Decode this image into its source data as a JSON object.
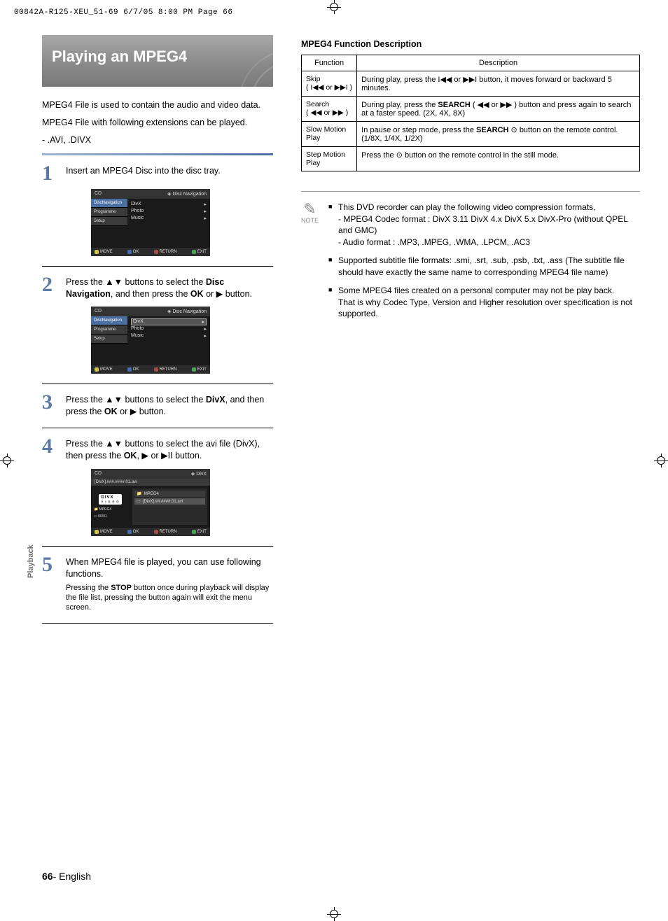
{
  "print_header": "00842A-R125-XEU_51-69  6/7/05  8:00 PM  Page 66",
  "side_tab": "Playback",
  "footer_page": "66",
  "footer_lang": "- English",
  "title": "Playing an MPEG4",
  "intro_lines": [
    "MPEG4 File is used to contain the audio and video data.",
    "MPEG4 File with following extensions can be played.",
    "- .AVI, .DIVX"
  ],
  "steps": {
    "s1": {
      "num": "1",
      "text": "Insert an MPEG4 Disc into the disc tray."
    },
    "s2": {
      "num": "2",
      "text_pre": "Press the ",
      "arrows": "▲▼",
      "text_mid": " buttons to select the ",
      "bold1": "Disc Navigation",
      "text_mid2": ", and then press the ",
      "bold2": "OK",
      "text_end": " or ▶ button."
    },
    "s3": {
      "num": "3",
      "text_pre": "Press the ",
      "arrows": "▲▼",
      "text_mid": " buttons to select the ",
      "bold1": "DivX",
      "text_mid2": ", and then press the ",
      "bold2": "OK",
      "text_end": " or ▶ button."
    },
    "s4": {
      "num": "4",
      "text_pre": "Press the ",
      "arrows": "▲▼",
      "text_mid": " buttons to select the avi file (DivX), then press the ",
      "bold1": "OK",
      "text_end": ", ▶ or ▶II button."
    },
    "s5": {
      "num": "5",
      "text": "When MPEG4 file is played, you can use following functions.",
      "sub_pre": "Pressing the ",
      "sub_bold": "STOP",
      "sub_post": " button once during playback will display the file list, pressing the button again will exit the menu screen."
    }
  },
  "osd_common": {
    "title_left": "CD",
    "nav_label": "Disc Navigation",
    "side_items": [
      "DiscNavigation",
      "Programme",
      "Setup"
    ],
    "main_items": [
      "DivX",
      "Photo",
      "Music"
    ],
    "bottom": {
      "move": "MOVE",
      "ok": "OK",
      "return": "RETURN",
      "exit": "EXIT"
    }
  },
  "osd3": {
    "title_left": "CD",
    "title_right": "DivX",
    "bar": "[DivX].###.####.01.avi",
    "logo": "DIVX",
    "logo_sub": "V I D E O",
    "left_meta1": "MPEG4",
    "left_meta2": "00/01",
    "right_h": "MPEG4",
    "right_row": "[DivX].##.####.01.avi"
  },
  "right": {
    "heading": "MPEG4 Function Description",
    "th_func": "Function",
    "th_desc": "Description",
    "rows": [
      {
        "name_l1": "Skip",
        "name_l2": "( I◀◀ or ▶▶I )",
        "desc_pre": "During play, press the ",
        "desc_sym": "I◀◀  or  ▶▶I",
        "desc_post": " button, it moves forward or backward 5 minutes."
      },
      {
        "name_l1": "Search",
        "name_l2": "( ◀◀ or ▶▶ )",
        "desc_pre": "During play, press the ",
        "desc_bold": "SEARCH",
        "desc_mid": " ( ",
        "desc_sym": "◀◀  or  ▶▶",
        "desc_mid2": " ) button and press again to search at a faster speed. (2X, 4X, 8X)"
      },
      {
        "name_l1": "Slow Motion",
        "name_l2": "Play",
        "desc_pre": "In pause or step mode, press the ",
        "desc_bold": "SEARCH",
        "desc_sym": " ⊙ ",
        "desc_post": "button on the remote control. (1/8X, 1/4X, 1/2X)"
      },
      {
        "name_l1": "Step Motion",
        "name_l2": "Play",
        "desc_pre": "Press the ",
        "desc_sym": "⊙",
        "desc_post": " button on the remote control in the still mode."
      }
    ]
  },
  "notes": {
    "label": "NOTE",
    "items": [
      "This DVD recorder can play the following video compression formats,\n- MPEG4 Codec format : DivX 3.11 DivX 4.x DivX 5.x DivX-Pro (without QPEL and GMC)\n- Audio format : .MP3, .MPEG, .WMA, .LPCM, .AC3",
      "Supported subtitle file formats: .smi, .srt, .sub, .psb, .txt, .ass (The subtitle file should have exactly the same name to corresponding MPEG4 file name)",
      "Some MPEG4 files created on a personal computer may not be play back.\nThat is why Codec Type, Version and Higher resolution over specification is not supported."
    ]
  }
}
